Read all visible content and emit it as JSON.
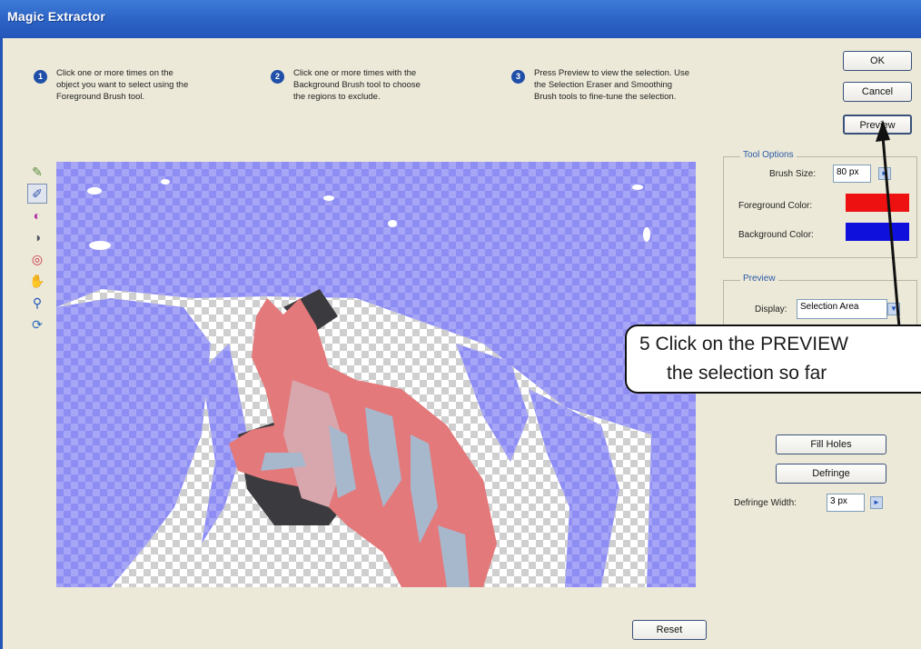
{
  "window": {
    "title": "Magic Extractor"
  },
  "steps": [
    {
      "number": "1",
      "text": "Click one or more times on the\nobject you want to select using the\nForeground Brush tool."
    },
    {
      "number": "2",
      "text": "Click one or more times with the\nBackground Brush tool to choose\nthe regions to exclude."
    },
    {
      "number": "3",
      "text": "Press Preview to view the selection. Use\nthe Selection Eraser and Smoothing\nBrush tools to fine-tune the selection."
    }
  ],
  "buttons": {
    "ok": "OK",
    "cancel": "Cancel",
    "preview": "Preview",
    "reset": "Reset",
    "fill_holes": "Fill Holes",
    "defringe": "Defringe"
  },
  "tool_options": {
    "legend": "Tool Options",
    "brush_size_label": "Brush Size:",
    "brush_size_value": "80 px",
    "foreground_label": "Foreground Color:",
    "background_label": "Background Color:",
    "foreground_color": "#ee1111",
    "background_color": "#1010dd"
  },
  "preview_group": {
    "legend": "Preview",
    "display_label": "Display:",
    "display_value": "Selection Area"
  },
  "touch_up": {
    "defringe_width_label": "Defringe Width:",
    "defringe_width_value": "3 px"
  },
  "tools": [
    {
      "name": "foreground-brush-icon",
      "glyph": "✎"
    },
    {
      "name": "background-brush-icon",
      "glyph": "✐"
    },
    {
      "name": "point-eraser-icon",
      "glyph": "◐"
    },
    {
      "name": "selection-eraser-icon",
      "glyph": "◑"
    },
    {
      "name": "smoothing-brush-icon",
      "glyph": "◎"
    },
    {
      "name": "hand-icon",
      "glyph": "✋"
    },
    {
      "name": "zoom-icon",
      "glyph": "⚲"
    },
    {
      "name": "rotate-icon",
      "glyph": "⟳"
    }
  ],
  "callout": {
    "line1": "5  Click on the PREVIEW",
    "line2": "the selection so far"
  },
  "colors": {
    "title_bar": "#2456b8",
    "dialog_bg": "#ece9d8",
    "mask_blue": "#8d8cf2",
    "subject_red": "#e0787a"
  }
}
